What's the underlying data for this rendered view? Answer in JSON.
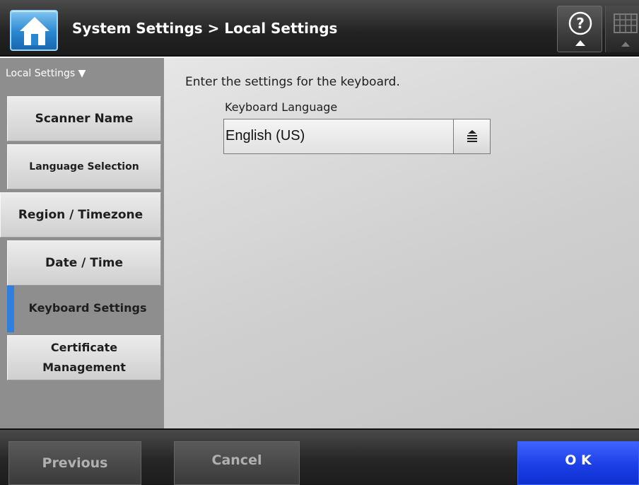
{
  "header": {
    "title": "System Settings > Local Settings",
    "home_icon": "home-icon",
    "help_icon": "help-icon",
    "keyboard_icon": "keyboard-icon"
  },
  "sidebar": {
    "title": "Local Settings ▼",
    "items": [
      {
        "label": "Scanner Name"
      },
      {
        "label": "Language Selection"
      },
      {
        "label": "Region / Timezone"
      },
      {
        "label": "Date / Time"
      },
      {
        "label": "Keyboard Settings",
        "active": true
      },
      {
        "label": "Certificate Management"
      }
    ]
  },
  "main": {
    "instruction": "Enter the settings for the keyboard.",
    "keyboard_language": {
      "label": "Keyboard Language",
      "value": "English (US)"
    }
  },
  "footer": {
    "previous_label": "Previous",
    "cancel_label": "Cancel",
    "ok_label": "O K"
  },
  "colors": {
    "accent_active": "#2f7fe0",
    "ok_button": "#1b3fe6",
    "home_button": "#2a86d0"
  }
}
